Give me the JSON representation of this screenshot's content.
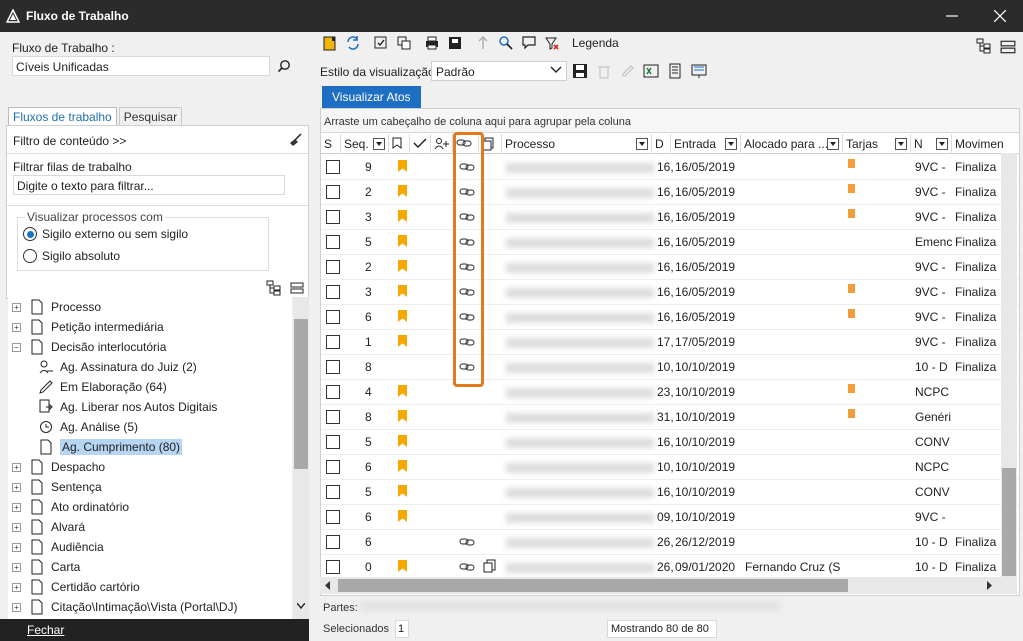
{
  "window": {
    "title": "Fluxo de Trabalho"
  },
  "left": {
    "fluxo_label": "Fluxo de Trabalho :",
    "fluxo_value": "Cíveis Unificadas",
    "tabs": [
      {
        "label": "Fluxos de trabalho",
        "active": true
      },
      {
        "label": "Pesquisar",
        "active": false
      }
    ],
    "filtro_conteudo": "Filtro de conteúdo >>",
    "filtrar_filas_label": "Filtrar filas de trabalho",
    "filtrar_placeholder": "Digite o texto para filtrar...",
    "visualizar_group": "Visualizar processos com",
    "radio_options": [
      {
        "label": "Sigilo externo ou sem sigilo",
        "checked": true
      },
      {
        "label": "Sigilo absoluto",
        "checked": false
      }
    ],
    "tree": [
      {
        "label": "Processo",
        "expander": "+",
        "icon": "document-icon"
      },
      {
        "label": "Petição intermediária",
        "expander": "+",
        "icon": "document-icon"
      },
      {
        "label": "Decisão interlocutória",
        "expander": "−",
        "icon": "document-icon"
      },
      {
        "label": "Ag. Assinatura do Juiz (2)",
        "child": true,
        "icon": "signature-icon"
      },
      {
        "label": "Em Elaboração (64)",
        "child": true,
        "icon": "pencil-icon"
      },
      {
        "label": "Ag. Liberar nos Autos Digitais",
        "child": true,
        "icon": "release-icon"
      },
      {
        "label": "Ag. Análise (5)",
        "child": true,
        "icon": "clock-icon"
      },
      {
        "label": "Ag. Cumprimento (80)",
        "child": true,
        "icon": "document-icon",
        "selected": true
      },
      {
        "label": "Despacho",
        "expander": "+",
        "icon": "document-icon"
      },
      {
        "label": "Sentença",
        "expander": "+",
        "icon": "document-icon"
      },
      {
        "label": "Ato ordinatório",
        "expander": "+",
        "icon": "document-icon"
      },
      {
        "label": "Alvará",
        "expander": "+",
        "icon": "document-icon"
      },
      {
        "label": "Audiência",
        "expander": "+",
        "icon": "document-icon"
      },
      {
        "label": "Carta",
        "expander": "+",
        "icon": "document-icon"
      },
      {
        "label": "Certidão cartório",
        "expander": "+",
        "icon": "document-icon"
      },
      {
        "label": "Citação\\Intimação\\Vista (Portal\\DJ)",
        "expander": "+",
        "icon": "document-icon"
      }
    ],
    "fechar": "Fechar"
  },
  "toolbar": {
    "legenda": "Legenda",
    "estilo_label": "Estilo da visualização",
    "estilo_value": "Padrão",
    "visualizar_atos": "Visualizar Atos"
  },
  "grid": {
    "group_tip": "Arraste um cabeçalho de coluna aqui para agrupar pela coluna",
    "headers": [
      "S",
      "Seq.",
      "",
      "",
      "",
      "",
      "",
      "Processo",
      "D",
      "Entrada",
      "Alocado para ...",
      "Tarjas",
      "N",
      "Movimen"
    ],
    "rows": [
      {
        "seq": "9",
        "bookmark": true,
        "link": true,
        "d": "16,",
        "entrada": "16/05/2019",
        "alocado": "",
        "tarja": true,
        "n": "9VC -",
        "mov": "Finaliza"
      },
      {
        "seq": "2",
        "bookmark": true,
        "link": true,
        "d": "16,",
        "entrada": "16/05/2019",
        "alocado": "",
        "tarja": true,
        "n": "9VC -",
        "mov": "Finaliza"
      },
      {
        "seq": "3",
        "bookmark": true,
        "link": true,
        "d": "16,",
        "entrada": "16/05/2019",
        "alocado": "",
        "tarja": true,
        "n": "9VC -",
        "mov": "Finaliza"
      },
      {
        "seq": "5",
        "bookmark": true,
        "link": true,
        "d": "16,",
        "entrada": "16/05/2019",
        "alocado": "",
        "tarja": false,
        "n": "Emenc",
        "mov": "Finaliza"
      },
      {
        "seq": "2",
        "bookmark": true,
        "link": true,
        "d": "16,",
        "entrada": "16/05/2019",
        "alocado": "",
        "tarja": false,
        "n": "9VC -",
        "mov": "Finaliza"
      },
      {
        "seq": "3",
        "bookmark": true,
        "link": true,
        "d": "16,",
        "entrada": "16/05/2019",
        "alocado": "",
        "tarja": true,
        "n": "9VC -",
        "mov": "Finaliza"
      },
      {
        "seq": "6",
        "bookmark": true,
        "link": true,
        "d": "16,",
        "entrada": "16/05/2019",
        "alocado": "",
        "tarja": true,
        "n": "9VC -",
        "mov": "Finaliza"
      },
      {
        "seq": "1",
        "bookmark": true,
        "link": true,
        "d": "17,",
        "entrada": "17/05/2019",
        "alocado": "",
        "tarja": false,
        "n": "9VC -",
        "mov": "Finaliza"
      },
      {
        "seq": "8",
        "bookmark": false,
        "link": true,
        "d": "10,",
        "entrada": "10/10/2019",
        "alocado": "",
        "tarja": false,
        "n": "10 - D",
        "mov": "Finaliza"
      },
      {
        "seq": "4",
        "bookmark": true,
        "link": false,
        "d": "23,",
        "entrada": "10/10/2019",
        "alocado": "",
        "tarja": true,
        "n": "NCPC",
        "mov": ""
      },
      {
        "seq": "8",
        "bookmark": true,
        "link": false,
        "d": "31,",
        "entrada": "10/10/2019",
        "alocado": "",
        "tarja": true,
        "n": "Genéri",
        "mov": ""
      },
      {
        "seq": "5",
        "bookmark": true,
        "link": false,
        "d": "16,",
        "entrada": "10/10/2019",
        "alocado": "",
        "tarja": false,
        "n": "CONV",
        "mov": ""
      },
      {
        "seq": "6",
        "bookmark": true,
        "link": false,
        "d": "10,",
        "entrada": "10/10/2019",
        "alocado": "",
        "tarja": false,
        "n": "NCPC",
        "mov": ""
      },
      {
        "seq": "5",
        "bookmark": true,
        "link": false,
        "d": "16,",
        "entrada": "10/10/2019",
        "alocado": "",
        "tarja": false,
        "n": "CONV",
        "mov": ""
      },
      {
        "seq": "6",
        "bookmark": true,
        "link": false,
        "d": "09,",
        "entrada": "10/10/2019",
        "alocado": "",
        "tarja": false,
        "n": "9VC -",
        "mov": ""
      },
      {
        "seq": "6",
        "bookmark": false,
        "link": true,
        "d": "26,",
        "entrada": "26/12/2019",
        "alocado": "",
        "tarja": false,
        "n": "10 - D",
        "mov": "Finaliza"
      },
      {
        "seq": "0",
        "bookmark": true,
        "link": true,
        "d": "26,",
        "entrada": "09/01/2020",
        "alocado": "Fernando Cruz (S",
        "tarja": false,
        "n": "10 - D",
        "mov": "Finaliza"
      }
    ]
  },
  "footer": {
    "partes_label": "Partes:",
    "selecionados_label": "Selecionados",
    "selecionados_value": "1",
    "mostrando": "Mostrando 80 de 80"
  }
}
